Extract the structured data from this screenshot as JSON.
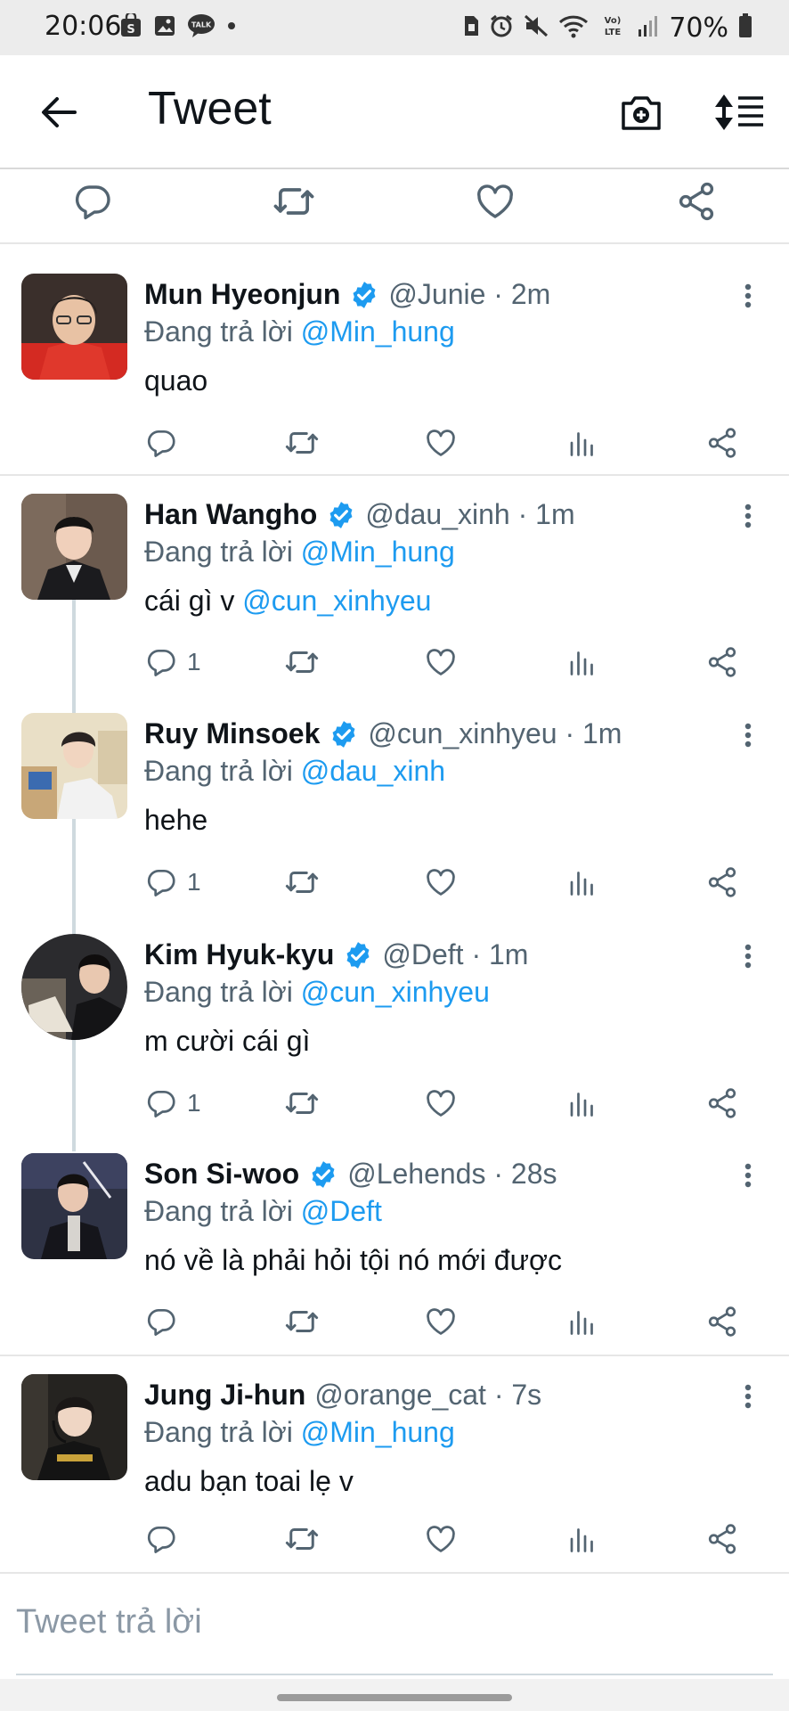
{
  "status_bar": {
    "time": "20:06",
    "left_icons": [
      "samsung-pay-icon",
      "gallery-icon",
      "kakaotalk-icon",
      "dot-icon"
    ],
    "right_icons": [
      "sim-icon",
      "alarm-icon",
      "mute-icon",
      "wifi-icon",
      "volte-icon",
      "signal-icon",
      "battery-icon"
    ],
    "volte_label": "Vo) LTE",
    "battery": "70%"
  },
  "header": {
    "title": "Tweet",
    "icons": [
      "back-arrow-icon",
      "camera-plus-icon",
      "sort-icon"
    ]
  },
  "reply_placeholder": "Tweet trả lời",
  "colors": {
    "accent": "#1d9bf0",
    "secondary_text": "#536471",
    "primary_text": "#0f1419",
    "divider": "#e6e6e6"
  },
  "tweets": [
    {
      "name": "Mun Hyeonjun",
      "verified": true,
      "handle": "@Junie",
      "time": "2m",
      "meta": "@Junie · 2m",
      "reply_prefix": "Đang trả lời",
      "reply_to": "@Min_hung",
      "text": "quao",
      "text_mention": "",
      "reply_count": ""
    },
    {
      "name": "Han Wangho",
      "verified": true,
      "handle": "@dau_xinh",
      "time": "1m",
      "meta": "@dau_xinh · 1m",
      "reply_prefix": "Đang trả lời",
      "reply_to": "@Min_hung",
      "text": "cái gì v",
      "text_mention": "@cun_xinhyeu",
      "reply_count": "1"
    },
    {
      "name": "Ruy Minsoek",
      "verified": true,
      "handle": "@cun_xinhyeu",
      "time": "1m",
      "meta": "@cun_xinhyeu · 1m",
      "reply_prefix": "Đang trả lời",
      "reply_to": "@dau_xinh",
      "text": "hehe",
      "text_mention": "",
      "reply_count": "1"
    },
    {
      "name": "Kim Hyuk-kyu",
      "verified": true,
      "handle": "@Deft",
      "time": "1m",
      "meta": "@Deft · 1m",
      "reply_prefix": "Đang trả lời",
      "reply_to": "@cun_xinhyeu",
      "text": "m cười cái gì",
      "text_mention": "",
      "reply_count": "1"
    },
    {
      "name": "Son Si-woo",
      "verified": true,
      "handle": "@Lehends",
      "time": "28s",
      "meta": "@Lehends · 28s",
      "reply_prefix": "Đang trả lời",
      "reply_to": "@Deft",
      "text": "nó về là phải hỏi tội nó mới được",
      "text_mention": "",
      "reply_count": ""
    },
    {
      "name": "Jung Ji-hun",
      "verified": false,
      "handle": "@orange_cat",
      "time": "7s",
      "meta": "@orange_cat · 7s",
      "reply_prefix": "Đang trả lời",
      "reply_to": "@Min_hung",
      "text": "adu bạn toai lẹ v",
      "text_mention": "",
      "reply_count": ""
    }
  ]
}
